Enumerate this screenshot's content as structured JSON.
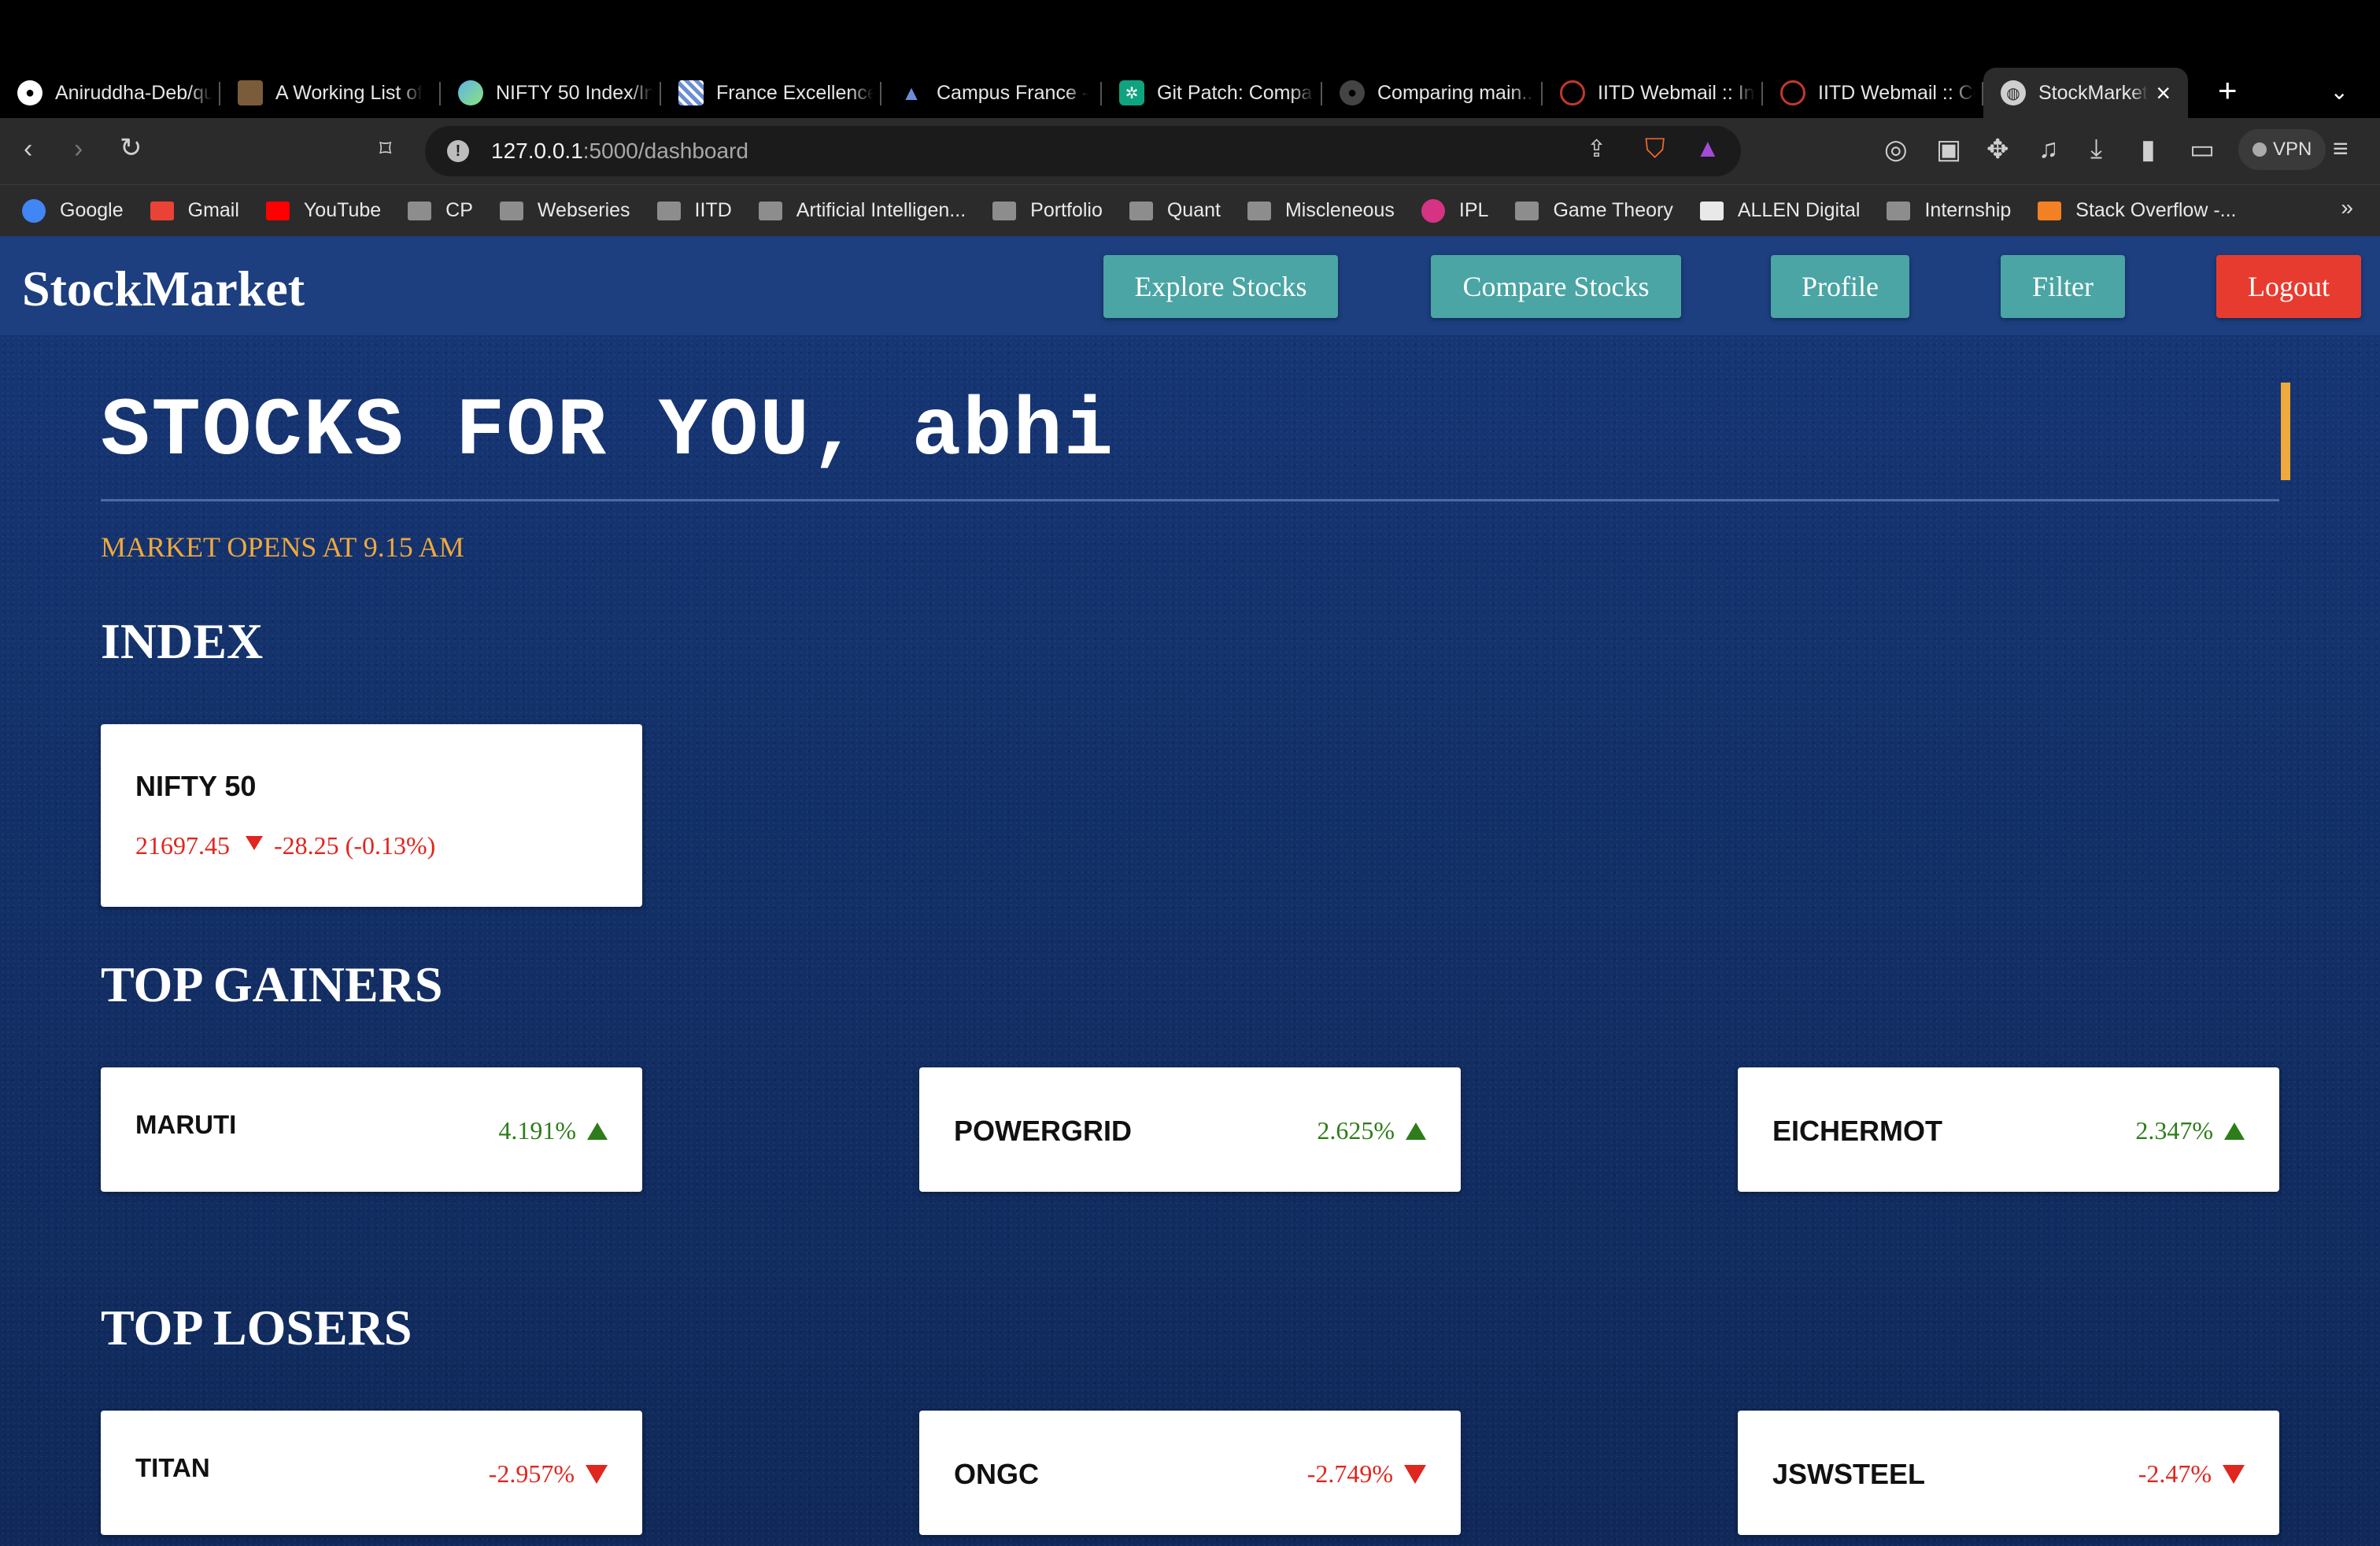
{
  "browser": {
    "tabs": [
      {
        "title": "Aniruddha-Deb/qu",
        "icon": "github-icon",
        "color": "#ffffff"
      },
      {
        "title": "A Working List of",
        "icon": "site-icon",
        "color": "#7a5c3a"
      },
      {
        "title": "NIFTY 50 Index/In",
        "icon": "nifty-icon",
        "color": "#5fb3e8"
      },
      {
        "title": "France Excellence",
        "icon": "france-icon",
        "color": "#6b8fd6"
      },
      {
        "title": "Campus France -",
        "icon": "campus-france-icon",
        "color": "#3d5fb0"
      },
      {
        "title": "Git Patch: Compar",
        "icon": "chatgpt-icon",
        "color": "#10a37f"
      },
      {
        "title": "Comparing main...",
        "icon": "github-icon",
        "color": "#ffffff"
      },
      {
        "title": "IITD Webmail :: Int",
        "icon": "webmail-icon",
        "color": "#c0392b"
      },
      {
        "title": "IITD Webmail :: Co",
        "icon": "webmail-icon",
        "color": "#c0392b"
      }
    ],
    "active_tab": {
      "title": "StockMarket",
      "close": "×"
    },
    "new_tab": "+",
    "tab_list": "⌄",
    "url": {
      "host": "127.0.0.1",
      "path": ":5000/dashboard"
    },
    "vpn_label": "VPN",
    "bookmarks": [
      {
        "label": "Google",
        "icon": "google-icon",
        "color": "#4285f4",
        "round": true
      },
      {
        "label": "Gmail",
        "icon": "gmail-icon",
        "color": "#ea4335",
        "round": false
      },
      {
        "label": "YouTube",
        "icon": "youtube-icon",
        "color": "#ff0000",
        "round": false
      },
      {
        "label": "CP",
        "icon": "folder-icon",
        "color": "#8d8d8d",
        "round": false
      },
      {
        "label": "Webseries",
        "icon": "folder-icon",
        "color": "#8d8d8d",
        "round": false
      },
      {
        "label": "IITD",
        "icon": "folder-icon",
        "color": "#8d8d8d",
        "round": false
      },
      {
        "label": "Artificial Intelligen...",
        "icon": "folder-icon",
        "color": "#8d8d8d",
        "round": false
      },
      {
        "label": "Portfolio",
        "icon": "folder-icon",
        "color": "#8d8d8d",
        "round": false
      },
      {
        "label": "Quant",
        "icon": "folder-icon",
        "color": "#8d8d8d",
        "round": false
      },
      {
        "label": "Miscleneous",
        "icon": "folder-icon",
        "color": "#8d8d8d",
        "round": false
      },
      {
        "label": "IPL",
        "icon": "ipl-icon",
        "color": "#d63384",
        "round": true
      },
      {
        "label": "Game Theory",
        "icon": "folder-icon",
        "color": "#8d8d8d",
        "round": false
      },
      {
        "label": "ALLEN Digital",
        "icon": "allen-icon",
        "color": "#e9e9e9",
        "round": false
      },
      {
        "label": "Internship",
        "icon": "folder-icon",
        "color": "#8d8d8d",
        "round": false
      },
      {
        "label": "Stack Overflow -...",
        "icon": "stackoverflow-icon",
        "color": "#f48024",
        "round": false
      }
    ],
    "bookmarks_overflow": "»"
  },
  "app": {
    "brand": "StockMarket",
    "nav": {
      "explore": "Explore Stocks",
      "compare": "Compare Stocks",
      "profile": "Profile",
      "filter": "Filter",
      "logout": "Logout"
    },
    "heading": "STOCKS FOR YOU, abhi",
    "market_status": "MARKET OPENS AT 9.15 AM",
    "index_title": "INDEX",
    "index": {
      "name": "NIFTY 50",
      "value": "21697.45",
      "change": "-28.25 (-0.13%)",
      "direction": "down"
    },
    "gainers_title": "TOP GAINERS",
    "gainers": [
      {
        "symbol": "MARUTI",
        "change": "4.191%"
      },
      {
        "symbol": "POWERGRID",
        "change": "2.625%"
      },
      {
        "symbol": "EICHERMOT",
        "change": "2.347%"
      }
    ],
    "losers_title": "TOP LOSERS",
    "losers": [
      {
        "symbol": "TITAN",
        "change": "-2.957%"
      },
      {
        "symbol": "ONGC",
        "change": "-2.749%"
      },
      {
        "symbol": "JSWSTEEL",
        "change": "-2.47%"
      }
    ],
    "colors": {
      "accent": "#4aa5a4",
      "logout": "#e83b2f",
      "gain": "#2e7d1a",
      "loss": "#e0261f",
      "highlight": "#f0a93c",
      "navbar": "#1d3e7f"
    }
  }
}
